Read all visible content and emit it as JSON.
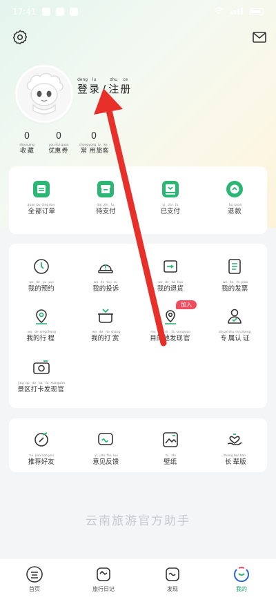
{
  "status_bar": {
    "time": "17:41"
  },
  "user": {
    "login_chars": [
      {
        "hz": "登",
        "py": "deng"
      },
      {
        "hz": "录",
        "py": "lu"
      }
    ],
    "slash": "/",
    "register_chars": [
      {
        "hz": "注",
        "py": "zhu"
      },
      {
        "hz": "册",
        "py": "ce"
      }
    ]
  },
  "stats": [
    {
      "value": "0",
      "label": [
        {
          "hz": "收",
          "py": "shou"
        },
        {
          "hz": "藏",
          "py": "cang"
        }
      ]
    },
    {
      "value": "0",
      "label": [
        {
          "hz": "优",
          "py": "you"
        },
        {
          "hz": "惠",
          "py": "hui"
        },
        {
          "hz": "券",
          "py": "quan"
        }
      ]
    },
    {
      "value": "0",
      "label": [
        {
          "hz": "常",
          "py": "chang"
        },
        {
          "hz": "用",
          "py": "yong"
        },
        {
          "hz": "旅",
          "py": "lv"
        },
        {
          "hz": "客",
          "py": "ke"
        }
      ]
    }
  ],
  "orders": [
    {
      "icon": "all-orders-icon",
      "label": [
        {
          "hz": "全",
          "py": "quan"
        },
        {
          "hz": "部",
          "py": "bu"
        },
        {
          "hz": "订",
          "py": "ding"
        },
        {
          "hz": "单",
          "py": "dan"
        }
      ]
    },
    {
      "icon": "pending-payment-icon",
      "label": [
        {
          "hz": "待",
          "py": "dai"
        },
        {
          "hz": "支",
          "py": "zhi"
        },
        {
          "hz": "付",
          "py": "fu"
        }
      ]
    },
    {
      "icon": "paid-icon",
      "label": [
        {
          "hz": "已",
          "py": "yi"
        },
        {
          "hz": "支",
          "py": "zhi"
        },
        {
          "hz": "付",
          "py": "fu"
        }
      ]
    },
    {
      "icon": "refund-icon",
      "label": [
        {
          "hz": "退",
          "py": "tui"
        },
        {
          "hz": "款",
          "py": "kuan"
        }
      ]
    }
  ],
  "services": [
    {
      "icon": "reservation-clock-icon",
      "label": [
        {
          "hz": "我",
          "py": "wo"
        },
        {
          "hz": "的",
          "py": "de"
        },
        {
          "hz": "预",
          "py": "yu"
        },
        {
          "hz": "约",
          "py": "yue"
        }
      ]
    },
    {
      "icon": "complaint-icon",
      "label": [
        {
          "hz": "我",
          "py": "wo"
        },
        {
          "hz": "的",
          "py": "de"
        },
        {
          "hz": "投",
          "py": "tou"
        },
        {
          "hz": "诉",
          "py": "su"
        }
      ]
    },
    {
      "icon": "return-goods-icon",
      "label": [
        {
          "hz": "我",
          "py": "wo"
        },
        {
          "hz": "的",
          "py": "de"
        },
        {
          "hz": "退",
          "py": "tui"
        },
        {
          "hz": "货",
          "py": "huo"
        }
      ]
    },
    {
      "icon": "invoice-icon",
      "label": [
        {
          "hz": "我",
          "py": "wo"
        },
        {
          "hz": "的",
          "py": "de"
        },
        {
          "hz": "发",
          "py": "fa"
        },
        {
          "hz": "票",
          "py": "piao"
        }
      ]
    },
    {
      "icon": "itinerary-pin-icon",
      "label": [
        {
          "hz": "我",
          "py": "wo"
        },
        {
          "hz": "的",
          "py": "de"
        },
        {
          "hz": "行",
          "py": "xing"
        },
        {
          "hz": "程",
          "py": "cheng"
        }
      ]
    },
    {
      "icon": "tip-pot-icon",
      "label": [
        {
          "hz": "我",
          "py": "wo"
        },
        {
          "hz": "的",
          "py": "de"
        },
        {
          "hz": "打",
          "py": "da"
        },
        {
          "hz": "赏",
          "py": "shang"
        }
      ]
    },
    {
      "icon": "destination-officer-icon",
      "badge": "加入",
      "label": [
        {
          "hz": "目",
          "py": "mu"
        },
        {
          "hz": "的",
          "py": "de"
        },
        {
          "hz": "地",
          "py": "di"
        },
        {
          "hz": "发",
          "py": "fa"
        },
        {
          "hz": "现",
          "py": "xian"
        },
        {
          "hz": "官",
          "py": "guan"
        }
      ]
    },
    {
      "icon": "verified-person-icon",
      "label": [
        {
          "hz": "专",
          "py": "zhuan"
        },
        {
          "hz": "属",
          "py": "shu"
        },
        {
          "hz": "认",
          "py": "ren"
        },
        {
          "hz": "证",
          "py": "zheng"
        }
      ]
    },
    {
      "icon": "camera-icon",
      "label": [
        {
          "hz": "景",
          "py": "jing"
        },
        {
          "hz": "区",
          "py": "qu"
        },
        {
          "hz": "打",
          "py": "da"
        },
        {
          "hz": "卡",
          "py": "ka"
        },
        {
          "hz": "发",
          "py": "fa"
        },
        {
          "hz": "现",
          "py": "xian"
        },
        {
          "hz": "官",
          "py": "guan"
        }
      ]
    }
  ],
  "more": [
    {
      "icon": "recommend-icon",
      "label": [
        {
          "hz": "推",
          "py": "tui"
        },
        {
          "hz": "荐",
          "py": "jian"
        },
        {
          "hz": "好",
          "py": "hao"
        },
        {
          "hz": "友",
          "py": "you"
        }
      ]
    },
    {
      "icon": "feedback-icon",
      "label": [
        {
          "hz": "意",
          "py": "yi"
        },
        {
          "hz": "见",
          "py": "jian"
        },
        {
          "hz": "反",
          "py": "fan"
        },
        {
          "hz": "馈",
          "py": "kui"
        }
      ]
    },
    {
      "icon": "wallpaper-icon",
      "label": [
        {
          "hz": "壁",
          "py": "bi"
        },
        {
          "hz": "纸",
          "py": "zhi"
        }
      ]
    },
    {
      "icon": "elder-mode-icon",
      "label": [
        {
          "hz": "长",
          "py": "zhang"
        },
        {
          "hz": "辈",
          "py": "bei"
        },
        {
          "hz": "版",
          "py": "ban"
        }
      ]
    }
  ],
  "slogan": "云南旅游官方助手",
  "tabs": [
    {
      "icon": "home-icon",
      "label": "首页",
      "active": false
    },
    {
      "icon": "travel-diary-icon",
      "label": "旅行日记",
      "active": false
    },
    {
      "icon": "discover-icon",
      "label": "发现",
      "active": false
    },
    {
      "icon": "mine-icon",
      "label": "我的",
      "active": true
    }
  ],
  "colors": {
    "accent": "#22a06b",
    "badge": "#ef4d5d",
    "annotation_arrow": "#e8302a"
  }
}
